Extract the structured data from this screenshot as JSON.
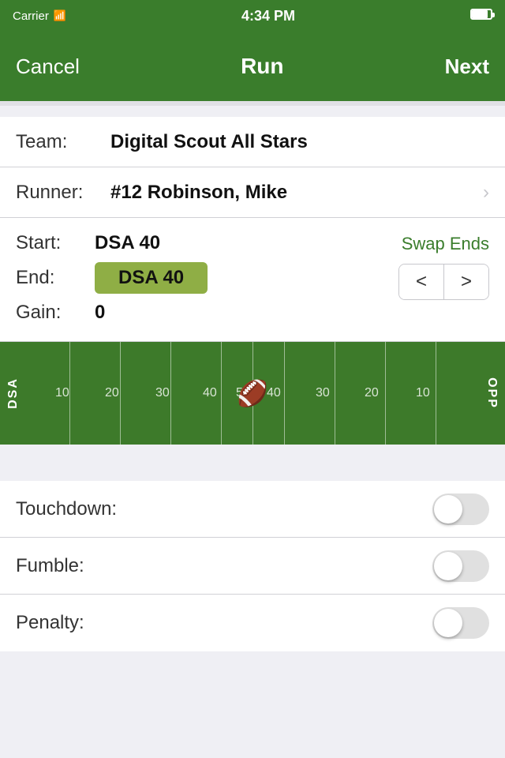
{
  "statusBar": {
    "carrier": "Carrier",
    "time": "4:34 PM"
  },
  "navBar": {
    "cancel": "Cancel",
    "title": "Run",
    "next": "Next"
  },
  "teamRow": {
    "label": "Team:",
    "value": "Digital Scout All Stars"
  },
  "runnerRow": {
    "label": "Runner:",
    "value": "#12 Robinson, Mike"
  },
  "startRow": {
    "label": "Start:",
    "value": "DSA 40"
  },
  "endRow": {
    "label": "End:",
    "value": "DSA 40"
  },
  "gainRow": {
    "label": "Gain:",
    "value": "0"
  },
  "swapEnds": "Swap Ends",
  "field": {
    "leftLabel": "DSA",
    "rightLabel": "OPP",
    "yardNumbers": [
      "10",
      "20",
      "30",
      "40",
      "50",
      "40",
      "30",
      "20",
      "10"
    ]
  },
  "toggles": {
    "touchdown": {
      "label": "Touchdown:",
      "value": false
    },
    "fumble": {
      "label": "Fumble:",
      "value": false
    },
    "penalty": {
      "label": "Penalty:",
      "value": false
    }
  },
  "stepper": {
    "decrement": "<",
    "increment": ">"
  }
}
